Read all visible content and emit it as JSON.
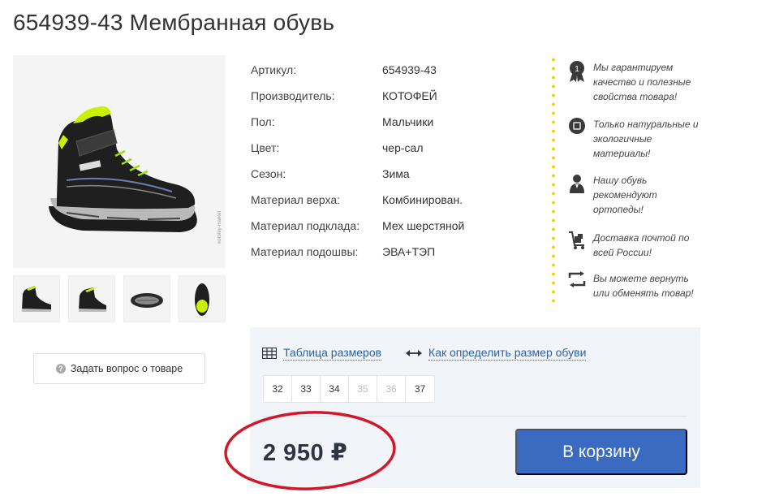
{
  "product": {
    "title": "654939-43 Мембранная обувь",
    "watermark": "kotofey-market"
  },
  "ask_button": {
    "label": "Задать вопрос о товаре"
  },
  "specs": [
    {
      "label": "Артикул:",
      "value": "654939-43"
    },
    {
      "label": "Производитель:",
      "value": "КОТОФЕЙ"
    },
    {
      "label": "Пол:",
      "value": "Мальчики"
    },
    {
      "label": "Цвет:",
      "value": "чер-сал"
    },
    {
      "label": "Сезон:",
      "value": "Зима"
    },
    {
      "label": "Материал верха:",
      "value": "Комбинирован."
    },
    {
      "label": "Материал подклада:",
      "value": "Мех шерстяной"
    },
    {
      "label": "Материал подошвы:",
      "value": "ЭВА+ТЭП"
    }
  ],
  "benefits": [
    {
      "icon": "award-medal-icon",
      "text": "Мы гарантируем качество и полезные свойства товара!"
    },
    {
      "icon": "natural-material-icon",
      "text": "Только натуральные и экологичные материалы!"
    },
    {
      "icon": "doctor-icon",
      "text": "Нашу обувь рекомендуют ортопеды!"
    },
    {
      "icon": "delivery-cart-icon",
      "text": "Доставка почтой по всей России!"
    },
    {
      "icon": "return-exchange-icon",
      "text": "Вы можете вернуть или обменять товар!"
    }
  ],
  "panel": {
    "size_table_link": "Таблица размеров",
    "size_guide_link": "Как определить размер обуви",
    "sizes": [
      {
        "label": "32",
        "available": true
      },
      {
        "label": "33",
        "available": true
      },
      {
        "label": "34",
        "available": true
      },
      {
        "label": "35",
        "available": false
      },
      {
        "label": "36",
        "available": false
      },
      {
        "label": "37",
        "available": true
      }
    ],
    "price": "2 950 ₽",
    "cart_button": "В корзину"
  },
  "colors": {
    "accent_blue": "#3a6bc0",
    "link_blue": "#2c5fa8",
    "dot_yellow": "#f2d200",
    "annotation_red": "#d0182a"
  }
}
